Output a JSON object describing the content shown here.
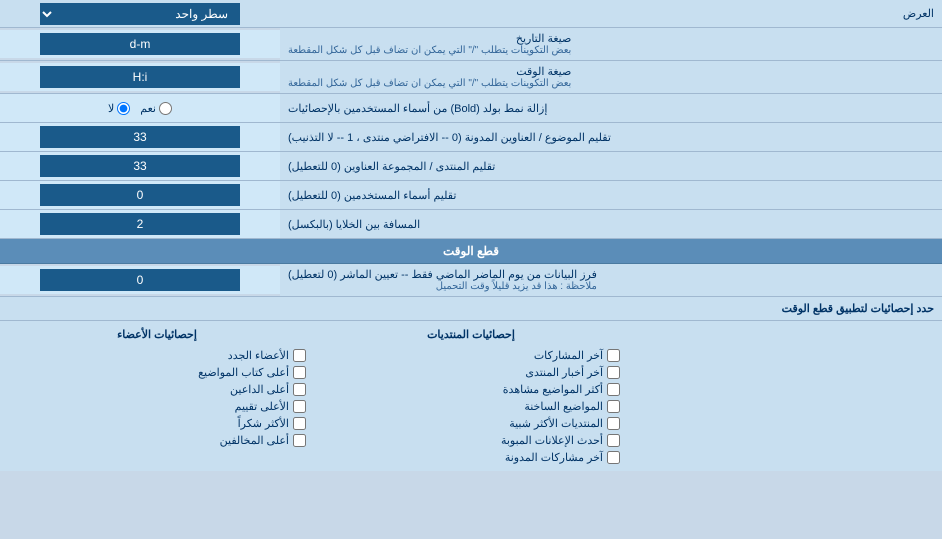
{
  "header": {
    "display_label": "العرض",
    "lines_label": "سطر واحد"
  },
  "rows": [
    {
      "id": "date_format",
      "label": "صيغة التاريخ",
      "sublabel": "بعض التكوينات يتطلب \"/\" التي يمكن ان تضاف قبل كل شكل المقطعة",
      "value": "d-m",
      "type": "input"
    },
    {
      "id": "time_format",
      "label": "صيغة الوقت",
      "sublabel": "بعض التكوينات يتطلب \"/\" التي يمكن ان تضاف قبل كل شكل المقطعة",
      "value": "H:i",
      "type": "input"
    },
    {
      "id": "bold_remove",
      "label": "إزالة نمط بولد (Bold) من أسماء المستخدمين بالإحصائيات",
      "value_yes": "نعم",
      "value_no": "لا",
      "selected": "no",
      "type": "radio"
    },
    {
      "id": "sort_topics",
      "label": "تقليم الموضوع / العناوين المدونة (0 -- الافتراضي منتدى ، 1 -- لا التذنيب)",
      "value": "33",
      "type": "input"
    },
    {
      "id": "sort_forum",
      "label": "تقليم المنتدى / المجموعة العناوين (0 للتعطيل)",
      "value": "33",
      "type": "input"
    },
    {
      "id": "sort_users",
      "label": "تقليم أسماء المستخدمين (0 للتعطيل)",
      "value": "0",
      "type": "input"
    },
    {
      "id": "space_cells",
      "label": "المسافة بين الخلايا (بالبكسل)",
      "value": "2",
      "type": "input"
    }
  ],
  "cutoff_section": {
    "title": "قطع الوقت",
    "row": {
      "label": "فرز البيانات من يوم الماضر الماضي فقط -- تعيين الماشر (0 لتعطيل)",
      "note": "ملاحظة : هذا قد يزيد قليلاً وقت التحميل",
      "value": "0"
    },
    "limit_label": "حدد إحصائيات لتطبيق قطع الوقت"
  },
  "checkboxes": {
    "col1_header": "إحصائيات المنتديات",
    "col2_header": "إحصائيات الأعضاء",
    "col1_items": [
      "آخر المشاركات",
      "آخر أخبار المنتدى",
      "أكثر المواضيع مشاهدة",
      "المواضيع الساخنة",
      "المنتديات الأكثر شبية",
      "أحدث الإعلانات المبوبة",
      "آخر مشاركات المدونة"
    ],
    "col2_items": [
      "الأعضاء الجدد",
      "أعلى كتاب المواضيع",
      "أعلى الداعين",
      "الأعلى تقييم",
      "الأكثر شكراً",
      "أعلى المخالفين"
    ]
  }
}
